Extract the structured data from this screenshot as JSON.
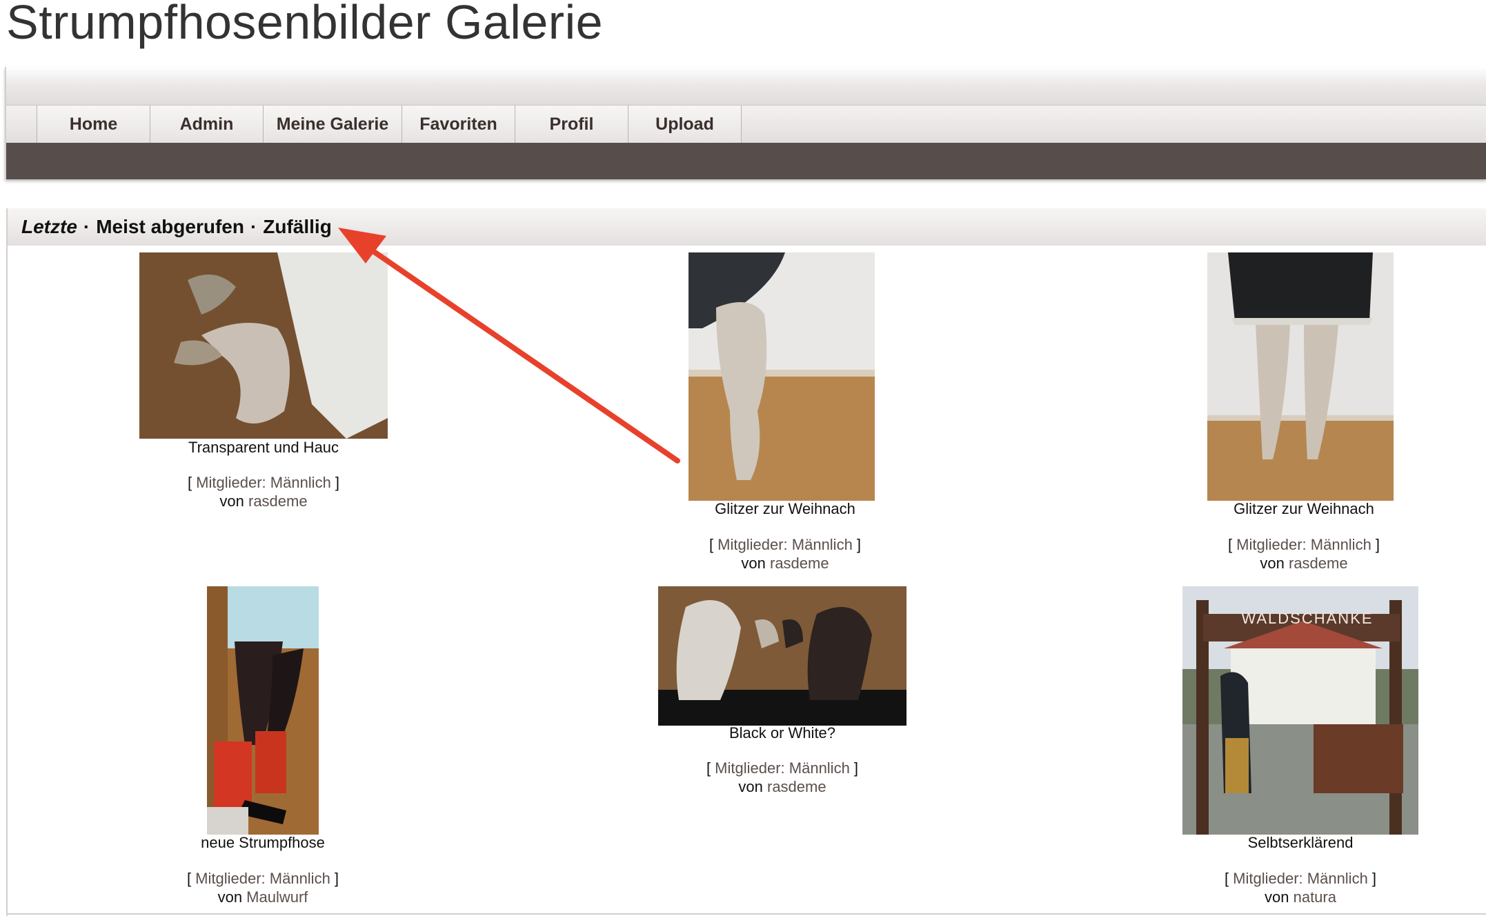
{
  "site": {
    "title": "Strumpfhosenbilder Galerie"
  },
  "nav": {
    "items": [
      {
        "label": "Home"
      },
      {
        "label": "Admin"
      },
      {
        "label": "Meine Galerie"
      },
      {
        "label": "Favoriten"
      },
      {
        "label": "Profil"
      },
      {
        "label": "Upload"
      }
    ]
  },
  "sort": {
    "latest": "Letzte",
    "most_viewed": "Meist abgerufen",
    "random": "Zufällig",
    "separator": "·"
  },
  "gallery": {
    "items": [
      {
        "title": "Transparent und Hauc",
        "category_prefix": "[ ",
        "category": "Mitglieder: Männlich",
        "category_suffix": " ]",
        "by": "von ",
        "author": "rasdeme"
      },
      {
        "title": "Glitzer zur Weihnach",
        "category_prefix": "[ ",
        "category": "Mitglieder: Männlich",
        "category_suffix": " ]",
        "by": "von ",
        "author": "rasdeme"
      },
      {
        "title": "Glitzer zur Weihnach",
        "category_prefix": "[ ",
        "category": "Mitglieder: Männlich",
        "category_suffix": " ]",
        "by": "von ",
        "author": "rasdeme"
      },
      {
        "title": "neue Strumpfhose",
        "category_prefix": "[ ",
        "category": "Mitglieder: Männlich",
        "category_suffix": " ]",
        "by": "von ",
        "author": "Maulwurf"
      },
      {
        "title": "Black or White?",
        "category_prefix": "[ ",
        "category": "Mitglieder: Männlich",
        "category_suffix": " ]",
        "by": "von ",
        "author": "rasdeme"
      },
      {
        "title": "Selbtserklärend",
        "category_prefix": "[ ",
        "category": "Mitglieder: Männlich",
        "category_suffix": " ]",
        "by": "von ",
        "author": "natura"
      }
    ],
    "sign_text": "WALDSCHÄNKE"
  },
  "colors": {
    "nav_dark": "#574e4c",
    "link": "#5b4f4b",
    "annotation": "#e8412b"
  }
}
